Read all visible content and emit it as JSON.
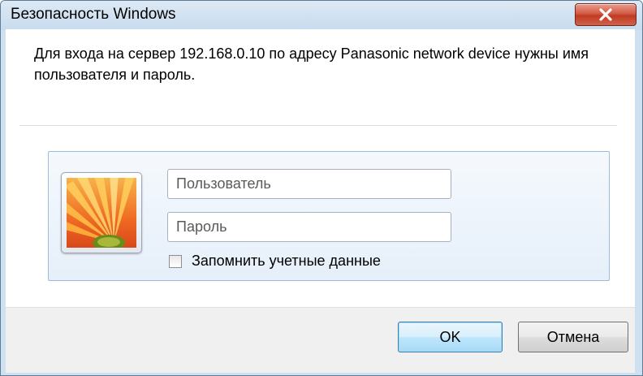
{
  "window": {
    "title": "Безопасность Windows"
  },
  "message": "Для входа на сервер 192.168.0.10 по адресу Panasonic network device нужны имя пользователя и пароль.",
  "credentials": {
    "username_placeholder": "Пользователь",
    "password_placeholder": "Пароль",
    "remember_label": "Запомнить учетные данные",
    "remember_checked": false
  },
  "buttons": {
    "ok_label": "OK",
    "cancel_label": "Отмена"
  },
  "icons": {
    "close": "close-icon",
    "user_tile": "flower-user-tile-icon"
  },
  "colors": {
    "close_button": "#c13a22",
    "ok_button_border": "#3c7fb1",
    "panel_border": "#9dbbdb"
  }
}
